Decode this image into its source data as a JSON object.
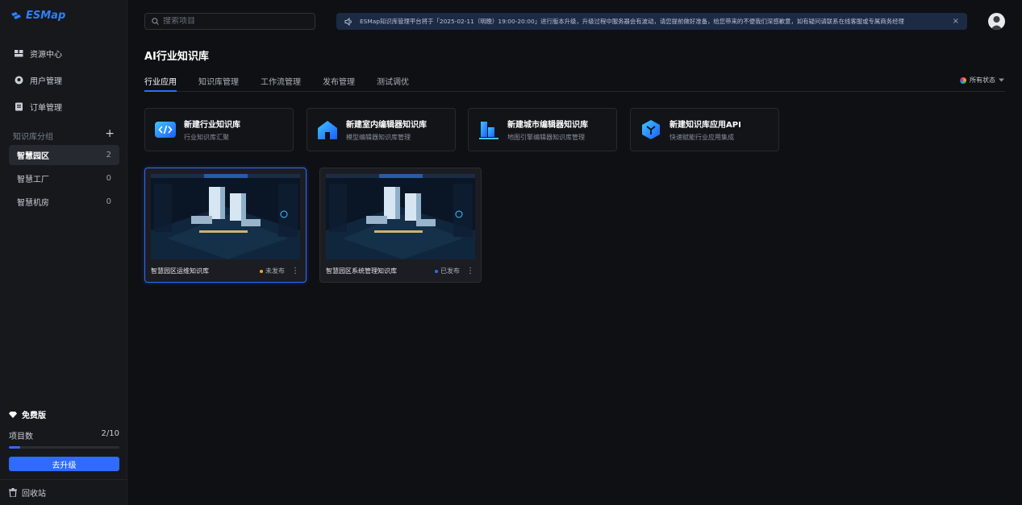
{
  "brand": {
    "name": "ESMap",
    "color": "#2f80ff"
  },
  "nav": [
    {
      "label": "资源中心",
      "icon": "grid-icon"
    },
    {
      "label": "用户管理",
      "icon": "user-circle-icon"
    },
    {
      "label": "订单管理",
      "icon": "document-icon"
    }
  ],
  "groups": {
    "heading": "知识库分组",
    "add_icon": "plus-icon",
    "items": [
      {
        "label": "智慧园区",
        "count": "2",
        "active": true
      },
      {
        "label": "智慧工厂",
        "count": "0"
      },
      {
        "label": "智慧机房",
        "count": "0"
      }
    ]
  },
  "plan": {
    "name": "免费版",
    "projects_label": "项目数",
    "projects_value": "2/10",
    "progress_fraction": 0.1,
    "upgrade_label": "去升级"
  },
  "trash_label": "回收站",
  "search": {
    "placeholder": "搜索项目"
  },
  "notice": {
    "text": "ESMap知识库管理平台将于「2025-02-11（明晚）19:00-20:00」进行版本升级，升级过程中服务器会有波动，请您提前做好准备，给您带来的不便我们深感歉意，如有疑问请联系在线客服或专属商务经理",
    "close": "×"
  },
  "page_title": "AI行业知识库",
  "tabs": [
    {
      "label": "行业应用",
      "active": true
    },
    {
      "label": "知识库管理"
    },
    {
      "label": "工作流管理"
    },
    {
      "label": "发布管理"
    },
    {
      "label": "测试调优"
    }
  ],
  "filter_label": "所有状态",
  "actions": [
    {
      "title": "新建行业知识库",
      "subtitle": "行业知识库汇聚",
      "icon": "code-icon"
    },
    {
      "title": "新建室内编辑器知识库",
      "subtitle": "模型编辑器知识库管理",
      "icon": "house-icon"
    },
    {
      "title": "新建城市编辑器知识库",
      "subtitle": "地图引擎编辑器知识库管理",
      "icon": "city-icon"
    },
    {
      "title": "新建知识库应用API",
      "subtitle": "快速赋能行业应用集成",
      "icon": "cube-icon"
    }
  ],
  "projects": [
    {
      "name": "智慧园区运维知识库",
      "status": "未发布",
      "status_color": "#f5a623",
      "selected": true
    },
    {
      "name": "智慧园区系统管理知识库",
      "status": "已发布",
      "status_color": "#2f6bff"
    }
  ],
  "colors": {
    "accent": "#2f6bff",
    "background": "#0e1013",
    "sidebar": "#16181c"
  }
}
